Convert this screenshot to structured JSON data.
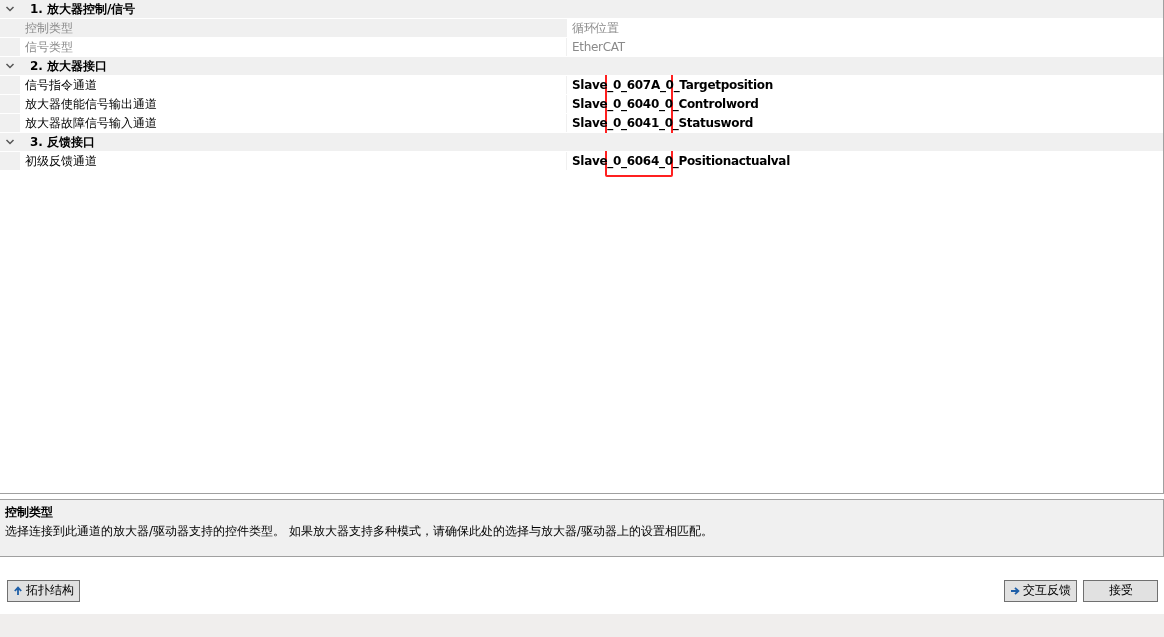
{
  "property_grid": {
    "sections": [
      {
        "title": "1. 放大器控制/信号",
        "expanded": true,
        "rows": [
          {
            "name": "控制类型",
            "value": "循环位置",
            "disabled": true,
            "selected": true
          },
          {
            "name": "信号类型",
            "value": "EtherCAT",
            "disabled": true,
            "selected": false
          }
        ]
      },
      {
        "title": "2. 放大器接口",
        "expanded": true,
        "rows": [
          {
            "name": "信号指令通道",
            "value": "Slave_0_607A_0_Targetposition",
            "disabled": false,
            "selected": false
          },
          {
            "name": "放大器使能信号输出通道",
            "value": "Slave_0_6040_0_Controlword",
            "disabled": false,
            "selected": false
          },
          {
            "name": "放大器故障信号输入通道",
            "value": "Slave_0_6041_0_Statusword",
            "disabled": false,
            "selected": false
          }
        ]
      },
      {
        "title": "3. 反馈接口",
        "expanded": true,
        "rows": [
          {
            "name": "初级反馈通道",
            "value": "Slave_0_6064_0_Positionactualval",
            "disabled": false,
            "selected": false
          }
        ]
      }
    ]
  },
  "description": {
    "title": "控制类型",
    "text": "选择连接到此通道的放大器/驱动器支持的控件类型。 如果放大器支持多种模式，请确保此处的选择与放大器/驱动器上的设置相匹配。"
  },
  "buttons": [
    {
      "label": "拓扑结构",
      "kind": "back"
    },
    {
      "label": "交互反馈",
      "kind": "next"
    },
    {
      "label": "接受",
      "kind": "plain"
    }
  ]
}
